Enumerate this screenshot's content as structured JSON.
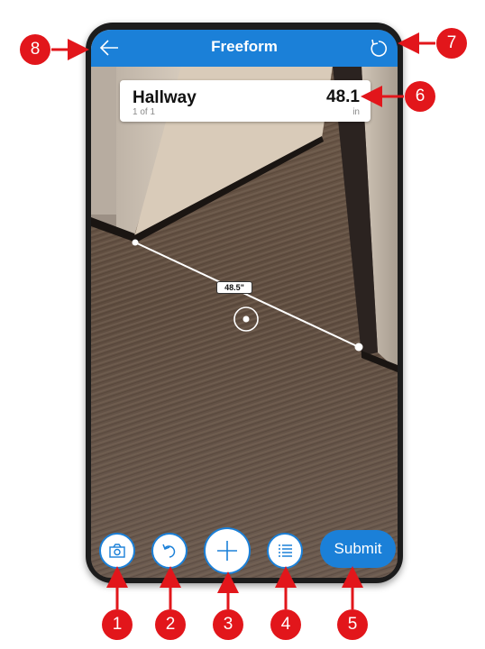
{
  "header": {
    "title": "Freeform",
    "back_icon": "back-arrow-icon",
    "reset_icon": "reset-icon",
    "color": "#1b80d8"
  },
  "measurement_card": {
    "name": "Hallway",
    "count": "1 of 1",
    "value": "48.1",
    "unit": "in"
  },
  "ar_view": {
    "segment_label": "48.5\"",
    "reticle_icon": "target-reticle-icon"
  },
  "toolbar": {
    "camera_icon": "camera-icon",
    "undo_icon": "undo-icon",
    "add_icon": "plus-icon",
    "list_icon": "checklist-icon",
    "submit_label": "Submit"
  },
  "callouts": [
    "1",
    "2",
    "3",
    "4",
    "5",
    "6",
    "7",
    "8"
  ],
  "callout_color": "#e2161b"
}
